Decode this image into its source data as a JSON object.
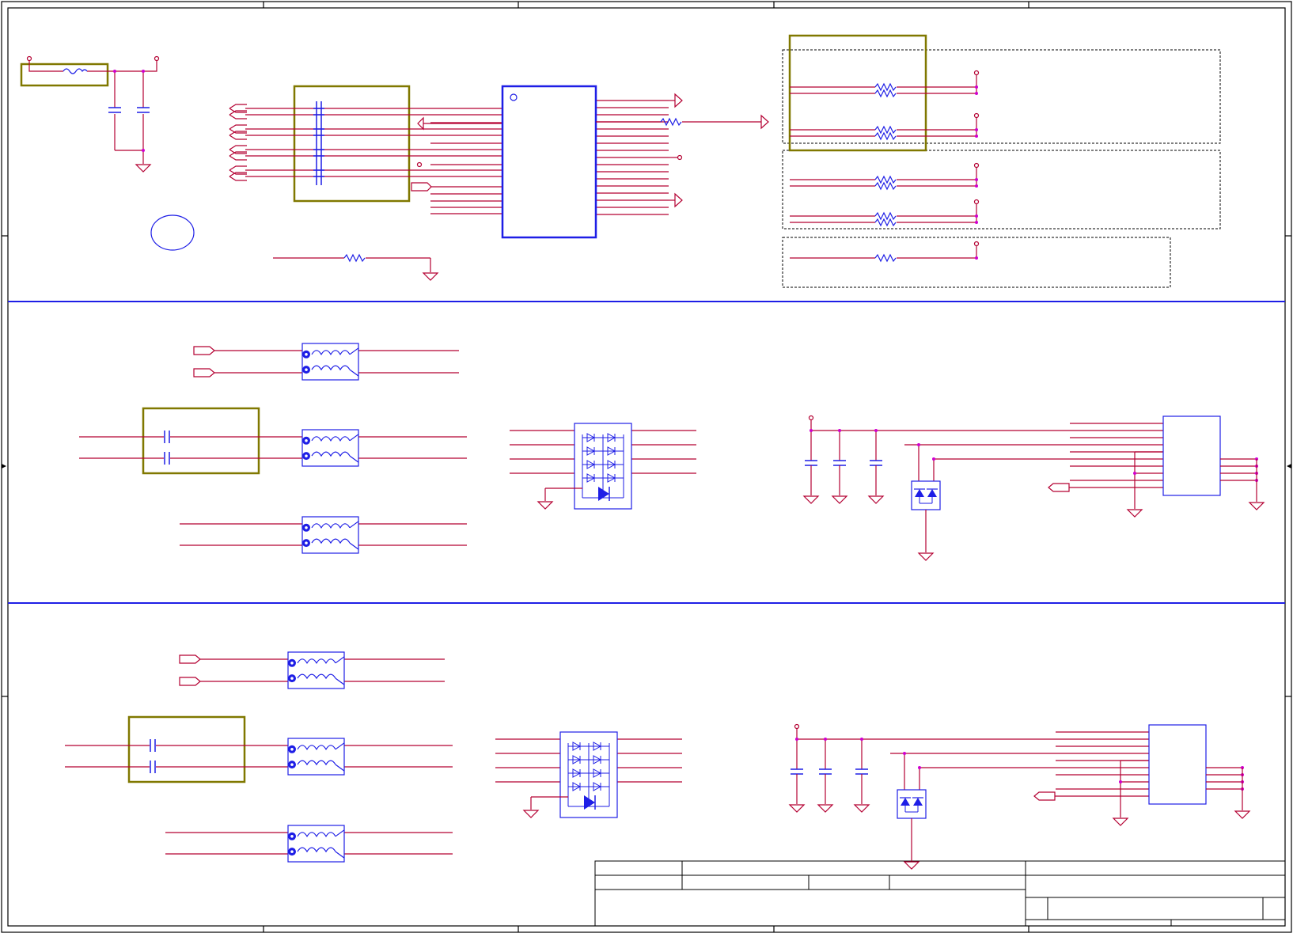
{
  "colors": {
    "wire": "#b40032",
    "component": "#1e1ee6",
    "highlight": "#807800",
    "junction": "#d000d0",
    "frame": "#000000",
    "divider": "#1e1ee6",
    "group_box": "#000000"
  },
  "sheet": {
    "border_text": "",
    "title_block_text": []
  },
  "icons": {
    "resistor": "resistor-icon",
    "capacitor": "capacitor-icon",
    "ground": "ground-icon",
    "power": "power-pin-icon",
    "port": "port-flag-icon",
    "choke": "common-mode-choke-icon",
    "tvs": "tvs-diode-icon",
    "ic": "ic-package-icon"
  }
}
